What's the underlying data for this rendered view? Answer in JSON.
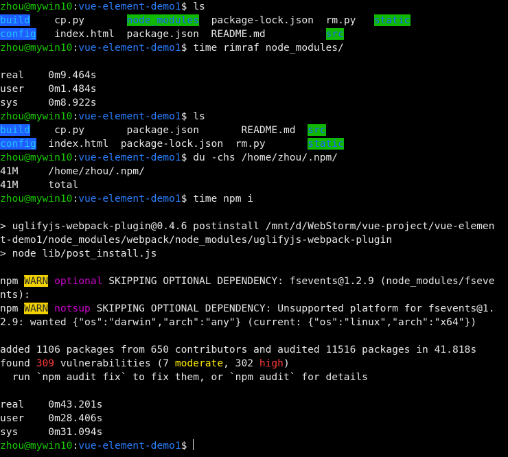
{
  "prompt": {
    "user": "zhou@mywin10",
    "colon": ":",
    "dir": "vue-element-demo1",
    "dollar": "$"
  },
  "commands": {
    "ls1": " ls",
    "rimraf": " time rimraf node_modules/",
    "ls2": " ls",
    "du": " du -chs /home/zhou/.npm/",
    "npmi": " time npm i",
    "final": " "
  },
  "ls1": {
    "row1": [
      "build",
      "cp.py",
      "node_modules",
      "package-lock.json",
      "rm.py",
      "static"
    ],
    "row2": [
      "config",
      "index.html",
      "package.json",
      "README.md",
      "src"
    ]
  },
  "timing1": {
    "real": "real    0m9.464s",
    "user": "user    0m1.484s",
    "sys": "sys     0m8.922s"
  },
  "ls2": {
    "row1": [
      "build",
      "cp.py",
      "package.json",
      "README.md",
      "src"
    ],
    "row2": [
      "config",
      "index.html",
      "package-lock.json",
      "rm.py",
      "static"
    ]
  },
  "du_output": {
    "line1": "41M     /home/zhou/.npm/",
    "line2": "41M     total"
  },
  "npm_output": {
    "post1": "> uglifyjs-webpack-plugin@0.4.6 postinstall /mnt/d/WebStorm/vue-project/vue-elemen",
    "post2": "t-demo1/node_modules/webpack/node_modules/uglifyjs-webpack-plugin",
    "post3": "> node lib/post_install.js",
    "warn1a": "npm ",
    "warn_label": "WARN",
    "optional": "optional",
    "warn1b": " SKIPPING OPTIONAL DEPENDENCY: fsevents@1.2.9 (node_modules/fseve",
    "warn1c": "nts):",
    "warn2a": "npm ",
    "notsup": "notsup",
    "warn2b": " SKIPPING OPTIONAL DEPENDENCY: Unsupported platform for fsevents@1.",
    "warn2c": "2.9: wanted {\"os\":\"darwin\",\"arch\":\"any\"} (current: {\"os\":\"linux\",\"arch\":\"x64\"})",
    "added": "added 1106 packages from 650 contributors and audited 11516 packages in 41.818s",
    "found_pre": "found ",
    "vuln_count": "309",
    "found_mid": " vulnerabilities (7 ",
    "moderate": "moderate",
    "found_mid2": ", 302 ",
    "high": "high",
    "found_end": ")",
    "audit": "  run `npm audit fix` to fix them, or `npm audit` for details"
  },
  "timing2": {
    "real": "real    0m43.201s",
    "user": "user    0m28.406s",
    "sys": "sys     0m31.094s"
  },
  "colors": {
    "background": "#000000",
    "prompt_green": "#19cb00",
    "path_blue": "#2a7fff",
    "text": "#e6e6e6",
    "warn_yellow": "#f2d200",
    "optional_magenta": "#d000d0",
    "danger_red": "#ff3b3b"
  }
}
